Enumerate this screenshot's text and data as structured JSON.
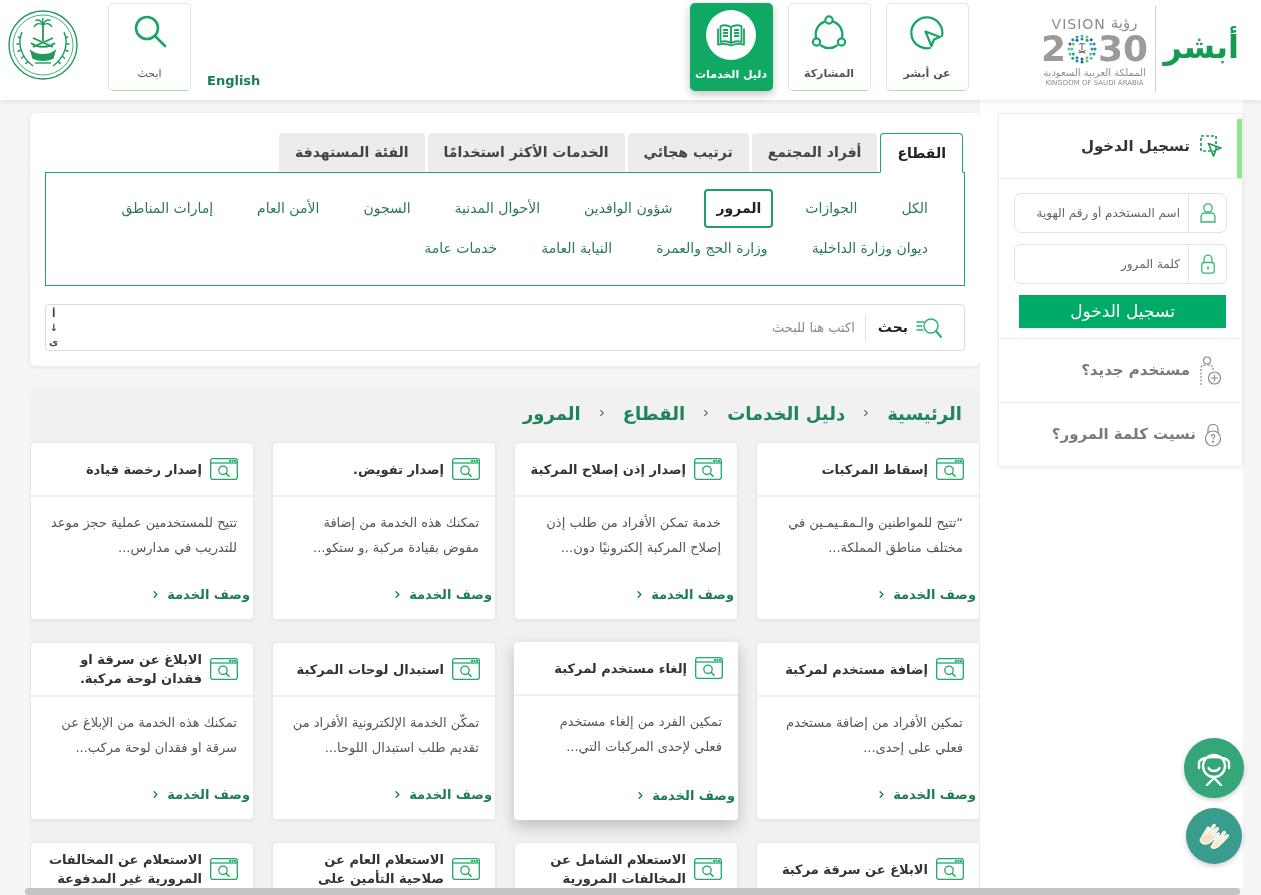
{
  "header": {
    "logo_text": "أبشر",
    "vision_logo": {
      "word_en": "VISION",
      "word_ar": "رؤية",
      "year_start": "2",
      "year_end": "30",
      "country_ar": "المملكة العربية السعودية",
      "country_en": "KINGDOM OF SAUDI ARABIA"
    },
    "nav": [
      {
        "label": "عن أبشر",
        "kind": "about",
        "selected": false
      },
      {
        "label": "المشاركة",
        "kind": "participation",
        "selected": false
      },
      {
        "label": "دليل الخدمات",
        "kind": "guide",
        "selected": true
      }
    ],
    "language_link": "English",
    "search_button": "ابحث"
  },
  "login": {
    "title": "تسجيل الدخول",
    "username_placeholder": "اسم المستخدم أو رقم الهوية",
    "password_placeholder": "كلمة المرور",
    "button": "تسجيل الدخول",
    "links": [
      {
        "kind": "new_user",
        "label": "مستخدم جديد؟"
      },
      {
        "kind": "forgot_password",
        "label": "نسيت كلمة المرور؟"
      }
    ]
  },
  "filters": {
    "tabs": [
      {
        "label": "القطاع",
        "selected": true
      },
      {
        "label": "أفراد المجتمع",
        "selected": false
      },
      {
        "label": "ترتيب هجائي",
        "selected": false
      },
      {
        "label": "الخدمات الأكثر استخدامًا",
        "selected": false
      },
      {
        "label": "الفئة المستهدفة",
        "selected": false
      }
    ],
    "categories": [
      {
        "label": "الكل",
        "selected": false
      },
      {
        "label": "الجوازات",
        "selected": false
      },
      {
        "label": "المرور",
        "selected": true
      },
      {
        "label": "شؤون الوافدين",
        "selected": false
      },
      {
        "label": "الأحوال المدنية",
        "selected": false
      },
      {
        "label": "السجون",
        "selected": false
      },
      {
        "label": "الأمن العام",
        "selected": false
      },
      {
        "label": "إمارات المناطق",
        "selected": false
      },
      {
        "label": "ديوان وزارة الداخلية",
        "selected": false
      },
      {
        "label": "وزارة الحج والعمرة",
        "selected": false
      },
      {
        "label": "النيابة العامة",
        "selected": false
      },
      {
        "label": "خدمات عامة",
        "selected": false
      }
    ],
    "search": {
      "button": "بحث",
      "placeholder": "اكتب هنا للبحث",
      "sort": {
        "top": "أ",
        "arrow": "↓",
        "bottom": "ى"
      }
    }
  },
  "breadcrumb": [
    "الرئيسية",
    "دليل الخدمات",
    "القطاع",
    "المرور"
  ],
  "services": [
    {
      "title": "إسقاط المركبات",
      "description": "“تتيح للمواطنين والـمقـيمـين في مختلف مناطق المملكة...",
      "link": "وصف الخدمة",
      "hovered": false
    },
    {
      "title": "إصدار إذن إصلاح المركبة",
      "description": "خدمة تمكن الأفراد من طلب إذن إصلاح المركبة إلكترونيًا دون...",
      "link": "وصف الخدمة",
      "hovered": false
    },
    {
      "title": "إصدار تفويض.",
      "description": "تمكنك هذه الخدمة من إضافة مفوض بقيادة مركبة ,و ستكو...",
      "link": "وصف الخدمة",
      "hovered": false
    },
    {
      "title": "إصدار رخصة قيادة",
      "description": "تتيح للمستخدمين عملية حجز موعد للتدريب في مدارس...",
      "link": "وصف الخدمة",
      "hovered": false
    },
    {
      "title": "إضافة مستخدم لمركبة",
      "description": "تمكين الأفراد من إضافة مستخدم فعلي على إحدى...",
      "link": "وصف الخدمة",
      "hovered": false
    },
    {
      "title": "إلغاء مستخدم لمركبة",
      "description": "تمكين الفرد من إلغاء مستخدم فعلي لإحدى المركبات التي...",
      "link": "وصف الخدمة",
      "hovered": true
    },
    {
      "title": "استبدال لوحات المركبة",
      "description": "تمكّن الخدمة الإلكترونية الأفراد من تقديم طلب استبدال اللوحا...",
      "link": "وصف الخدمة",
      "hovered": false
    },
    {
      "title": "الابلاغ عن سرقة او فقدان لوحة مركبة.",
      "description": "تمكنك هذه الخدمة من الإبلاغ عن سرقة او فقدان لوحة مركب...",
      "link": "وصف الخدمة",
      "hovered": false
    },
    {
      "title": "الابلاغ عن سرقة مركبة",
      "hovered": false
    },
    {
      "title": "الاستعلام الشامل عن المخالفات المرورية",
      "hovered": false
    },
    {
      "title": "الاستعلام العام عن صلاحية التأمين على",
      "hovered": false
    },
    {
      "title": "الاستعلام عن المخالفات المرورية غير المدفوعة",
      "hovered": false
    }
  ]
}
